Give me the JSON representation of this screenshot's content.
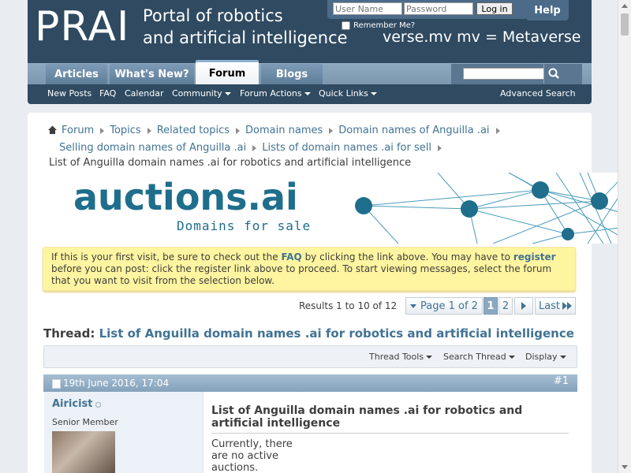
{
  "header": {
    "logo": "PRAI",
    "tagline_line1": "Portal of robotics",
    "tagline_line2": "and artificial intelligence",
    "marquee": "verse.mv mv = Metaverse"
  },
  "login": {
    "username_placeholder": "User Name",
    "password_placeholder": "Password",
    "login_label": "Log in",
    "remember_label": "Remember Me?",
    "help_label": "Help"
  },
  "nav": {
    "tabs": [
      {
        "label": "Articles"
      },
      {
        "label": "What's New?"
      },
      {
        "label": "Forum"
      },
      {
        "label": "Blogs"
      }
    ],
    "active_tab": "Forum"
  },
  "subnav": {
    "items": [
      {
        "label": "New Posts"
      },
      {
        "label": "FAQ"
      },
      {
        "label": "Calendar"
      },
      {
        "label": "Community"
      },
      {
        "label": "Forum Actions"
      },
      {
        "label": "Quick Links"
      }
    ],
    "advanced_search": "Advanced Search"
  },
  "breadcrumb": {
    "items": [
      {
        "label": "Forum"
      },
      {
        "label": "Topics"
      },
      {
        "label": "Related topics"
      },
      {
        "label": "Domain names"
      },
      {
        "label": "Domain names of Anguilla .ai"
      },
      {
        "label": "Selling domain names of Anguilla .ai"
      },
      {
        "label": "Lists of domain names .ai for sell"
      }
    ],
    "current": "List of Anguilla domain names .ai for robotics and artificial intelligence"
  },
  "banner": {
    "title": "auctions.ai",
    "subtitle": "Domains for sale"
  },
  "notice": {
    "text1": "If this is your first visit, be sure to check out the ",
    "faq_link": "FAQ",
    "text2": " by clicking the link above. You may have to ",
    "register_link": "register",
    "text3": " before you can post: click the register link above to proceed. To start viewing messages, select the forum that you want to visit from the selection below."
  },
  "pagination": {
    "results": "Results 1 to 10 of 12",
    "page_of": "Page 1 of 2",
    "current_page": "1",
    "page_2": "2",
    "last_label": "Last"
  },
  "thread": {
    "prefix": "Thread: ",
    "title": "List of Anguilla domain names .ai for robotics and artificial intelligence",
    "tools": [
      "Thread Tools",
      "Search Thread",
      "Display"
    ]
  },
  "post": {
    "date": "19th June 2016, 17:04",
    "number": "#1",
    "username": "Airicist",
    "user_title": "Senior Member",
    "title": "List of Anguilla domain names .ai for robotics and artificial intelligence",
    "body": "Currently, there are no active auctions."
  },
  "colors": {
    "header_bg": "#2f4a61",
    "link": "#417394",
    "notice_bg": "#fff5a0",
    "post_head": "#84a2bb"
  }
}
